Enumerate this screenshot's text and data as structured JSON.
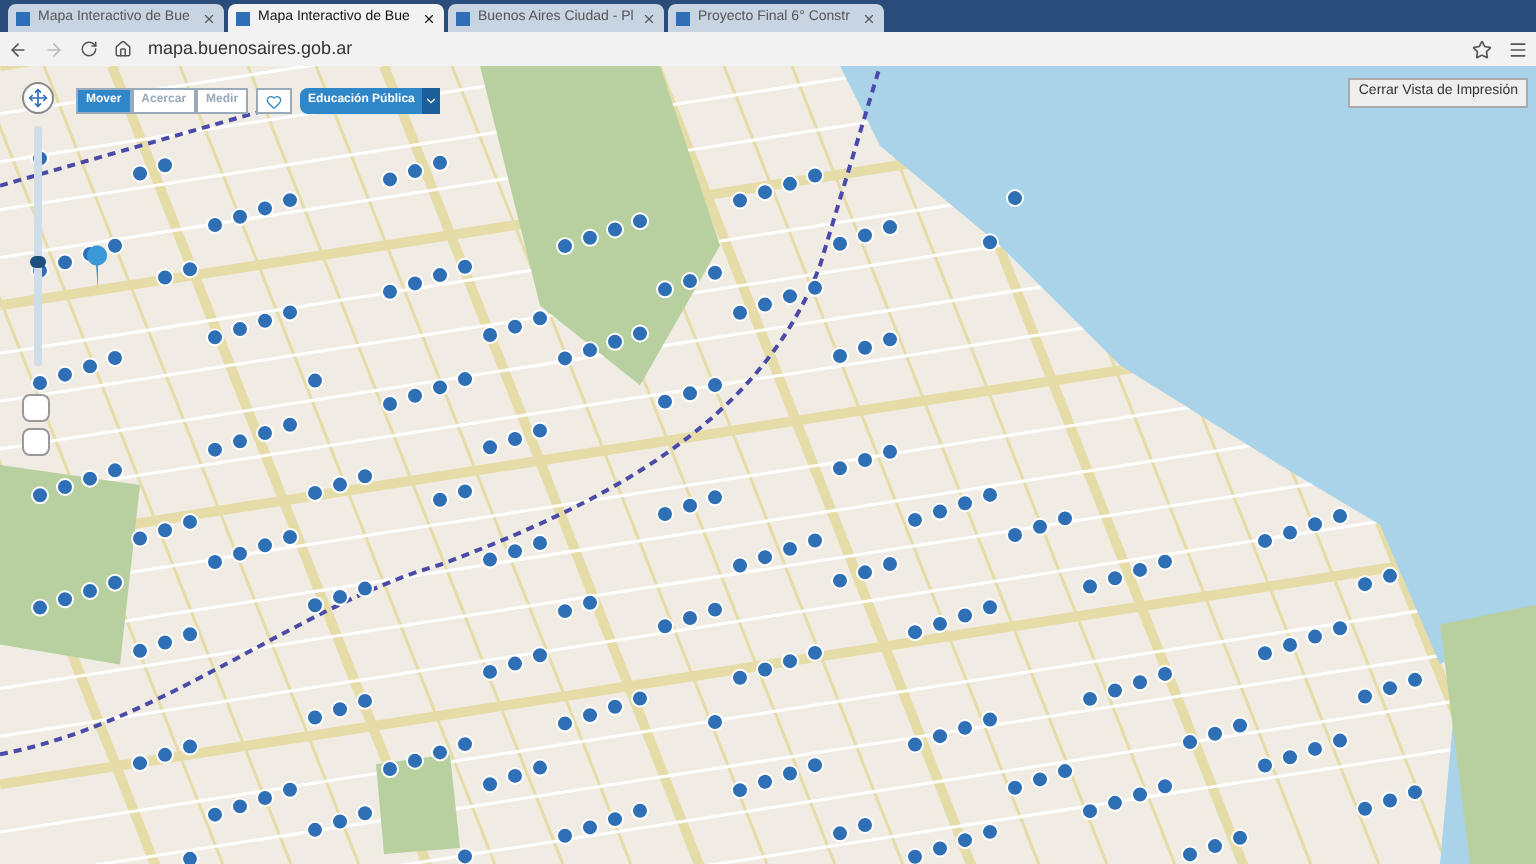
{
  "browser": {
    "tabs": [
      {
        "title": "Mapa Interactivo de Bue",
        "selected": false
      },
      {
        "title": "Mapa Interactivo de Bue",
        "selected": true
      },
      {
        "title": "Buenos Aires Ciudad - Pl",
        "selected": false
      },
      {
        "title": "Proyecto Final 6° Constr",
        "selected": false
      }
    ],
    "url": "mapa.buenosaires.gob.ar"
  },
  "map": {
    "tools": [
      {
        "label": "Mover",
        "selected": true
      },
      {
        "label": "Acercar",
        "selected": false
      },
      {
        "label": "Medir",
        "selected": false
      }
    ],
    "layer": "Educación Pública",
    "zoom": {
      "level": 0.43
    },
    "print_button": "Cerrar Vista de Impresión"
  }
}
